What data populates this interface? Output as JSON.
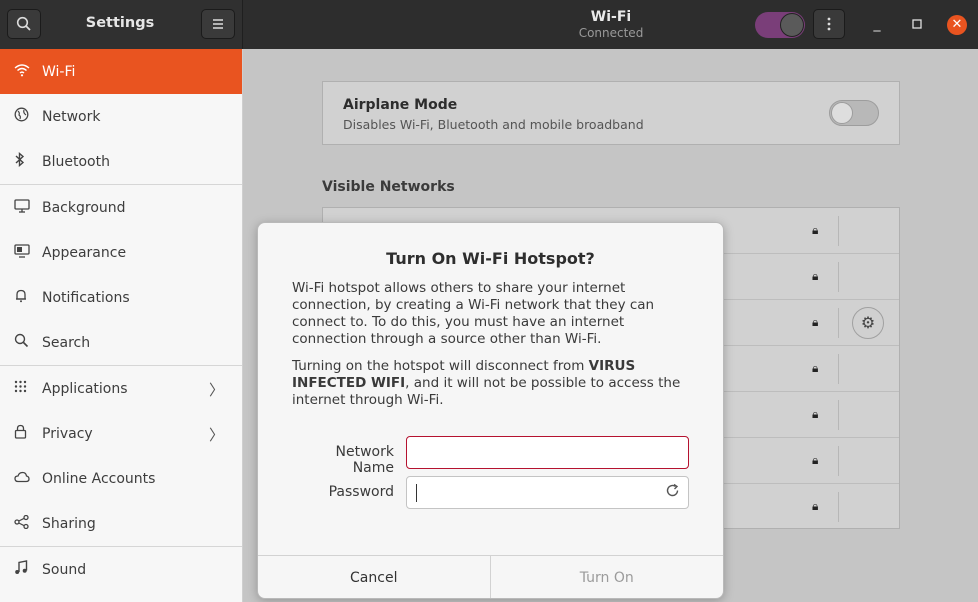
{
  "app": {
    "title": "Settings"
  },
  "header": {
    "title": "Wi-Fi",
    "subtitle": "Connected",
    "wifi_enabled": true
  },
  "sidebar": {
    "items": [
      {
        "label": "Wi-Fi",
        "icon": "wifi-icon",
        "active": true
      },
      {
        "label": "Network",
        "icon": "globe-icon"
      },
      {
        "label": "Bluetooth",
        "icon": "bluetooth-icon"
      },
      {
        "label": "Background",
        "icon": "monitor-icon"
      },
      {
        "label": "Appearance",
        "icon": "appearance-icon"
      },
      {
        "label": "Notifications",
        "icon": "bell-icon"
      },
      {
        "label": "Search",
        "icon": "search-icon"
      },
      {
        "label": "Applications",
        "icon": "apps-grid-icon",
        "submenu": true
      },
      {
        "label": "Privacy",
        "icon": "lock-icon",
        "submenu": true
      },
      {
        "label": "Online Accounts",
        "icon": "cloud-icon"
      },
      {
        "label": "Sharing",
        "icon": "share-icon"
      },
      {
        "label": "Sound",
        "icon": "music-note-icon"
      }
    ]
  },
  "main": {
    "airplane_mode": {
      "title": "Airplane Mode",
      "subtitle": "Disables Wi-Fi, Bluetooth and mobile broadband",
      "enabled": false
    },
    "visible_networks_title": "Visible Networks"
  },
  "dialog": {
    "title": "Turn On Wi-Fi Hotspot?",
    "paragraph1": "Wi-Fi hotspot allows others to share your internet connection, by creating a Wi-Fi network that they can connect to. To do this, you must have an internet connection through a source other than Wi-Fi.",
    "paragraph2_before": "Turning on the hotspot will disconnect from ",
    "paragraph2_network": "VIRUS INFECTED WIFI",
    "paragraph2_after": ", and it will not be possible to access the internet through Wi-Fi.",
    "network_name_label": "Network Name",
    "network_name_value": "",
    "password_label": "Password",
    "password_value": "",
    "cancel_label": "Cancel",
    "turn_on_label": "Turn On"
  },
  "colors": {
    "accent": "#e95420",
    "error_border": "#b5122f",
    "switch_on": "#7a3e79"
  }
}
